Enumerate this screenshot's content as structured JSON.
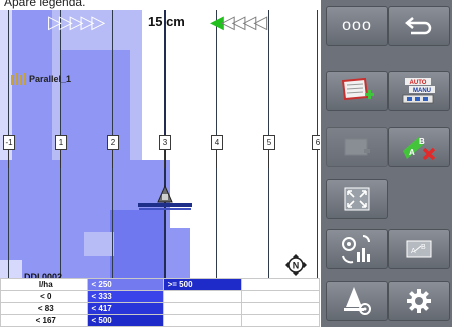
{
  "caption": "Apare legenda.",
  "guidance": {
    "offset": "15 cm",
    "left_arrows": "▷▷▷▷▷",
    "right_arrows_green": "◀",
    "right_arrows_grey": "◁◁◁◁"
  },
  "track": {
    "name": "Parallel_1"
  },
  "lanes": [
    "-1",
    "1",
    "2",
    "3",
    "4",
    "5",
    "6"
  ],
  "map_label": "DDI 0002",
  "legend": {
    "unit": "l/ha",
    "rows": [
      {
        "left": "< 0",
        "mid": "< 250",
        "right": ">= 500"
      },
      {
        "left": "< 83",
        "mid": "< 333",
        "right": ""
      },
      {
        "left": "< 167",
        "mid": "< 417",
        "right": ""
      },
      {
        "left": "",
        "mid": "< 500",
        "right": ""
      }
    ],
    "colors": [
      "#ffffff",
      "#7379ee",
      "#3a44e8",
      "#2a35d9",
      "#1f2bc8"
    ]
  },
  "panel": {
    "more_label": "ooo",
    "auto_label": "AUTO",
    "manu_label": "MANU"
  },
  "colors": {
    "coverage": "#8f96f3",
    "panel_bg": "#6d727a",
    "green": "#22c01e"
  }
}
